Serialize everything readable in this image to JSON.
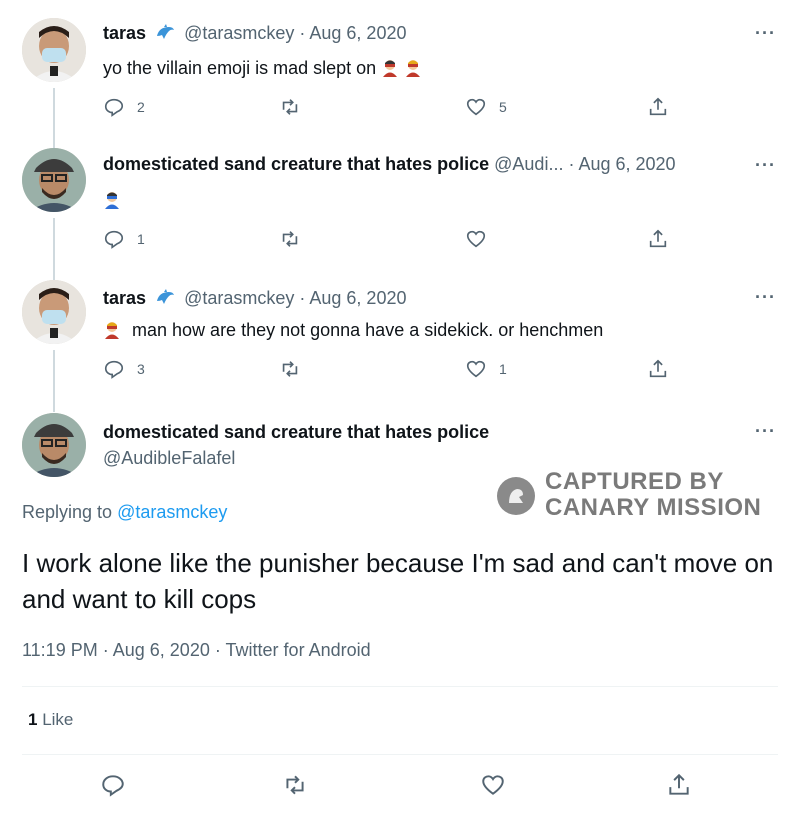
{
  "tweets": [
    {
      "name": "taras",
      "handle": "@tarasmckey",
      "date": "Aug 6, 2020",
      "text": "yo the villain emoji is mad slept on",
      "emojis": [
        "supervillain-emoji",
        "supervillain-emoji"
      ],
      "replies": "2",
      "retweets": "",
      "likes": "5",
      "avatar": "masked-man-avatar"
    },
    {
      "name": "domesticated sand creature that hates police",
      "handle": "@Audi...",
      "date": "Aug 6, 2020",
      "text": "",
      "emojis": [
        "superhero-emoji"
      ],
      "replies": "1",
      "retweets": "",
      "likes": "",
      "avatar": "cap-man-avatar"
    },
    {
      "name": "taras",
      "handle": "@tarasmckey",
      "date": "Aug 6, 2020",
      "text": "man how are they not gonna have a sidekick. or henchmen",
      "emojis": [
        "supervillain-emoji"
      ],
      "replies": "3",
      "retweets": "",
      "likes": "1",
      "avatar": "masked-man-avatar"
    }
  ],
  "main_tweet": {
    "name": "domesticated sand creature that hates police",
    "handle": "@AudibleFalafel",
    "replying_prefix": "Replying to",
    "replying_to": "@tarasmckey",
    "text": "I work alone like the punisher because I'm sad and can't move on and want to kill cops",
    "time": "11:19 PM",
    "date": "Aug 6, 2020",
    "source": "Twitter for Android",
    "like_count": "1",
    "like_label": "Like"
  },
  "watermark": {
    "line1": "CAPTURED BY",
    "line2": "CANARY MISSION"
  },
  "separator": "·",
  "more_label": "···",
  "colors": {
    "link": "#1d9bf0",
    "secondary": "#536471",
    "thread_line": "#cfd9de"
  }
}
